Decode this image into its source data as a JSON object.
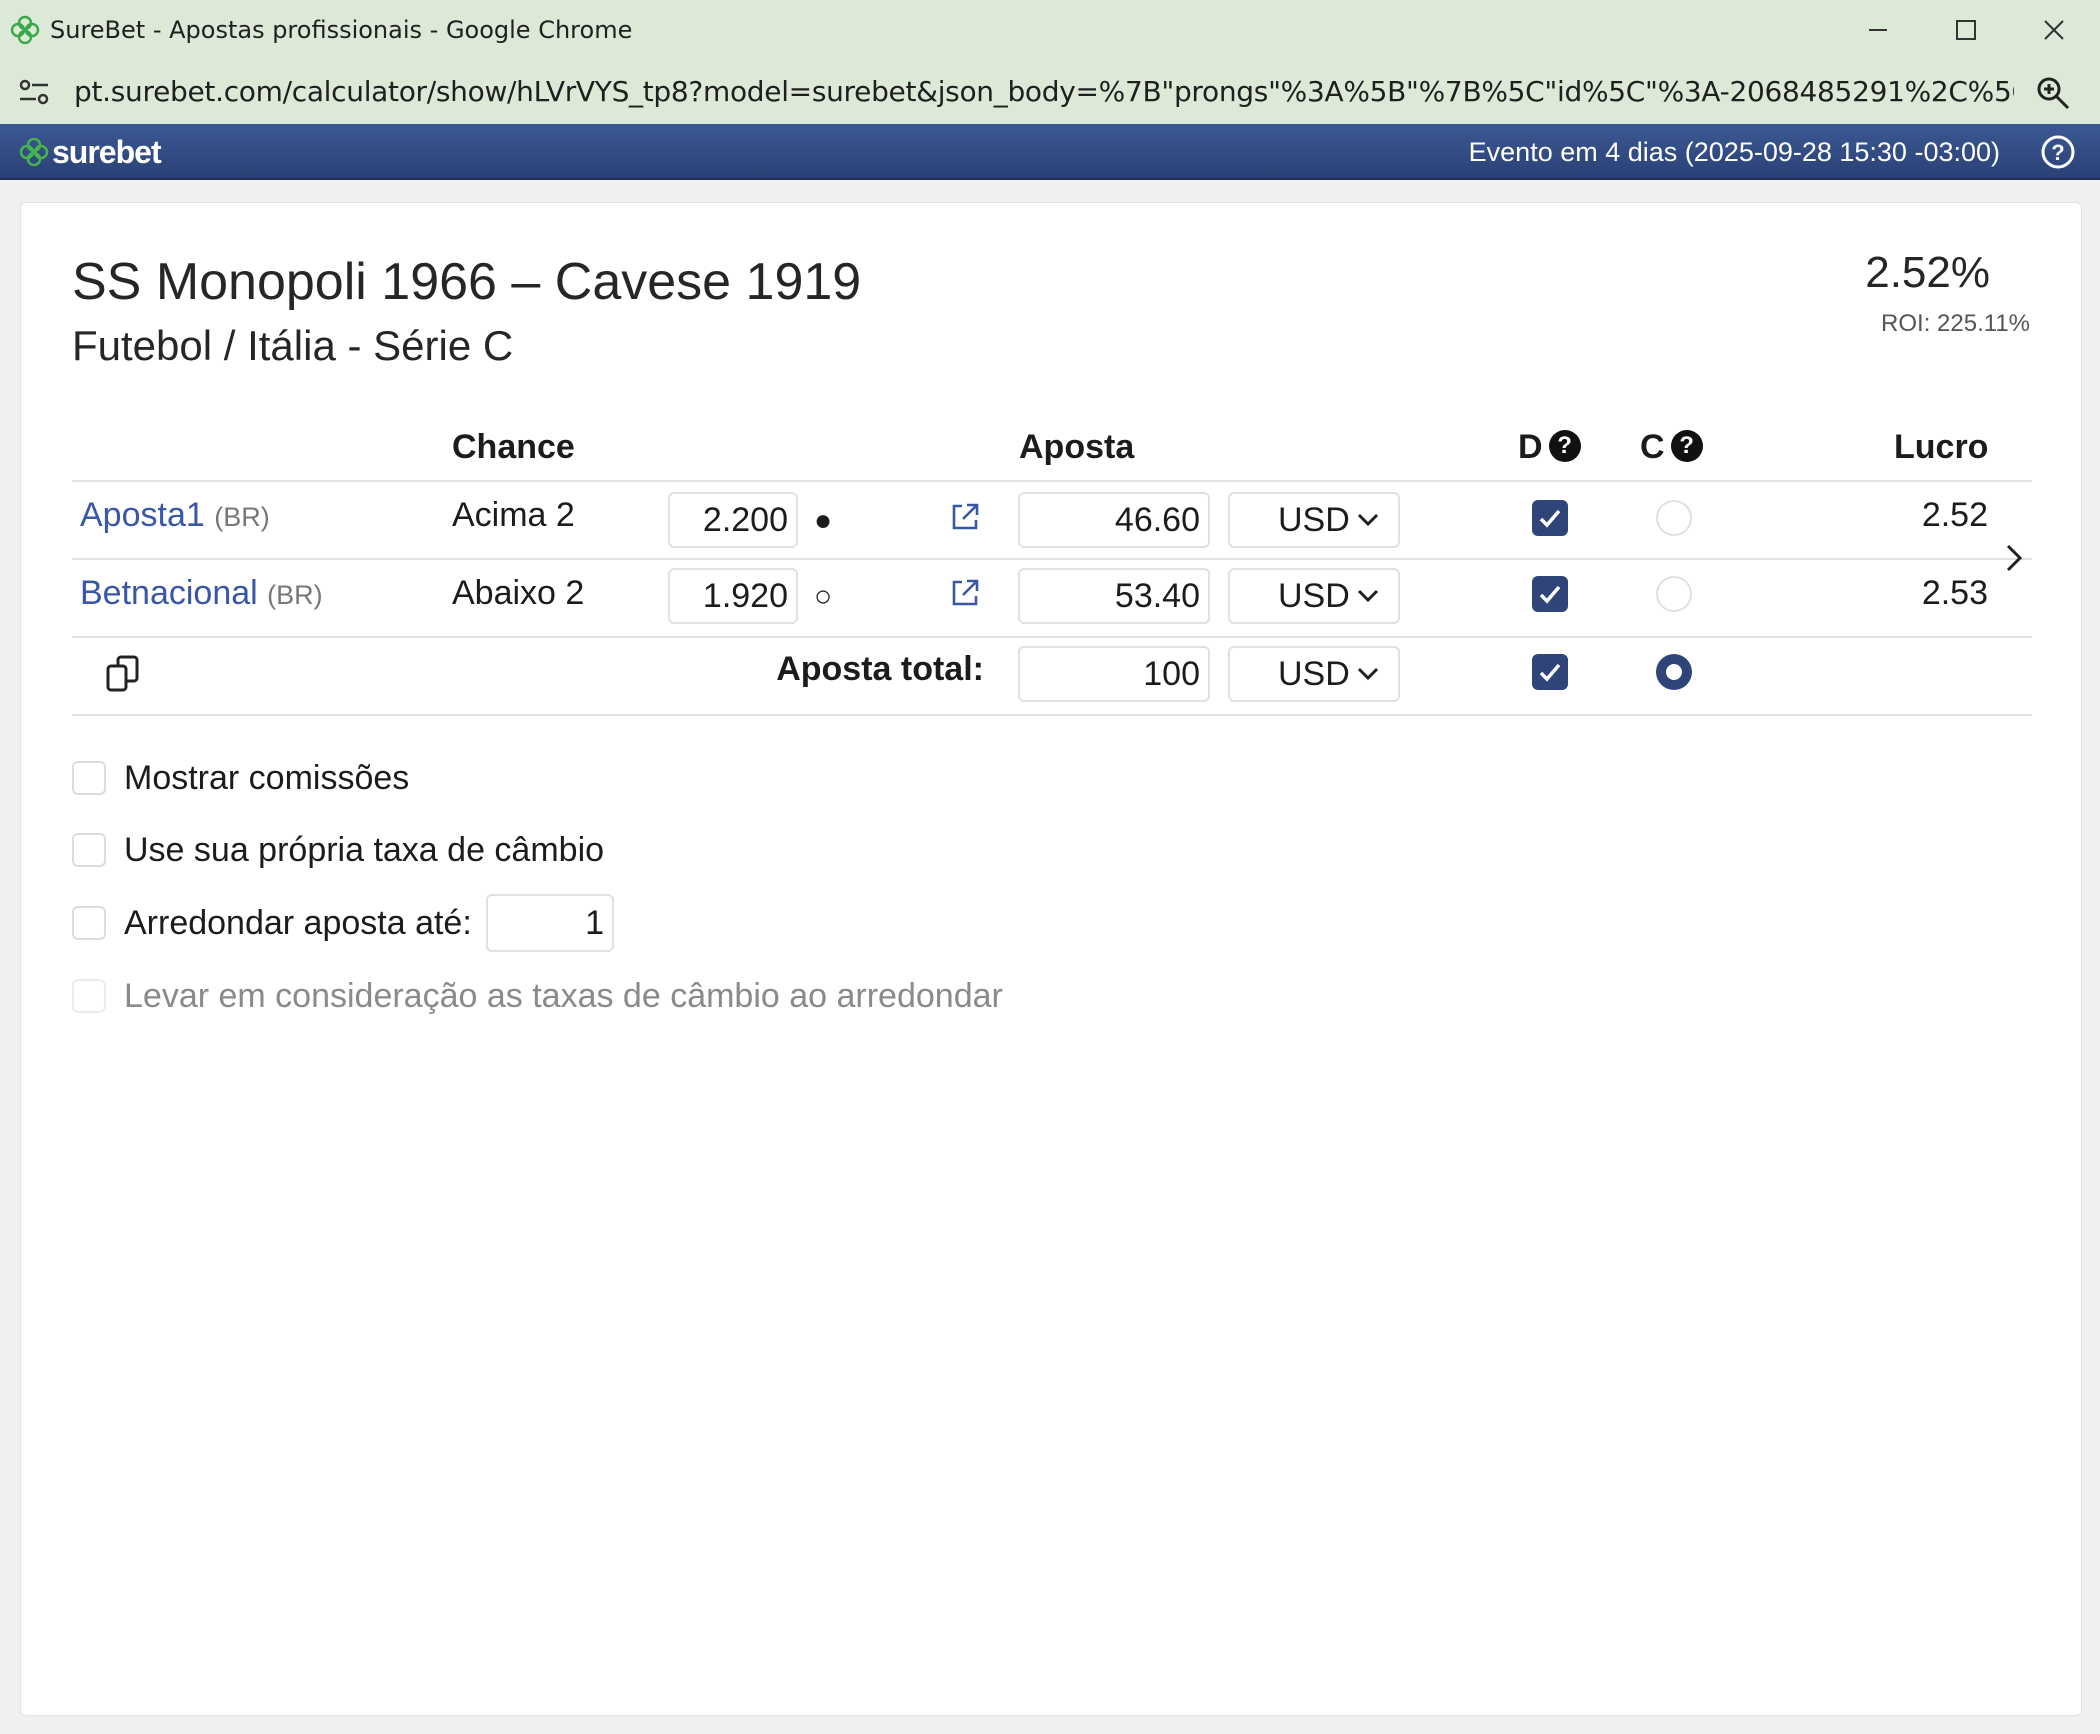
{
  "window": {
    "title": "SureBet - Apostas profissionais - Google Chrome",
    "url": "pt.surebet.com/calculator/show/hLVrVYS_tp8?model=surebet&json_body=%7B\"prongs\"%3A%5B\"%7B%5C\"id%5C\"%3A-2068485291%2C%5C\"similar_size%5C\"..."
  },
  "header": {
    "logo": "surebet",
    "event_info": "Evento em 4 dias (2025-09-28 15:30 -03:00)",
    "brand_color": "#2f4478"
  },
  "match": {
    "title": "SS Monopoli 1966 – Cavese 1919",
    "subtitle": "Futebol / Itália - Série C",
    "profit_percent": "2.52%",
    "roi": "ROI: 225.11%"
  },
  "table": {
    "headers": {
      "chance": "Chance",
      "aposta": "Aposta",
      "d": "D",
      "c": "C",
      "lucro": "Lucro",
      "help_mark": "?"
    },
    "rows": [
      {
        "bookmaker": "Aposta1",
        "region": "(BR)",
        "outcome": "Acima 2",
        "odds": "2.200",
        "marker": "●",
        "stake": "46.60",
        "currency": "USD",
        "d_checked": true,
        "c_selected": false,
        "profit": "2.52"
      },
      {
        "bookmaker": "Betnacional",
        "region": "(BR)",
        "outcome": "Abaixo 2",
        "odds": "1.920",
        "marker": "○",
        "stake": "53.40",
        "currency": "USD",
        "d_checked": true,
        "c_selected": false,
        "profit": "2.53"
      }
    ],
    "total": {
      "label": "Aposta total:",
      "stake": "100",
      "currency": "USD",
      "d_checked": true,
      "c_selected": true
    }
  },
  "options": {
    "show_commissions": "Mostrar comissões",
    "own_exchange_rate": "Use sua própria taxa de câmbio",
    "round_stake": "Arredondar aposta até:",
    "round_value": "1",
    "consider_exchange": "Levar em consideração as taxas de câmbio ao arredondar"
  },
  "icons": {
    "favicon": "surebet-clover-icon",
    "site_info": "tune-icon",
    "zoom": "zoom-icon",
    "help": "help-circle-icon",
    "external": "external-link-icon",
    "copy": "copy-icon",
    "next": "chevron-right-icon"
  }
}
